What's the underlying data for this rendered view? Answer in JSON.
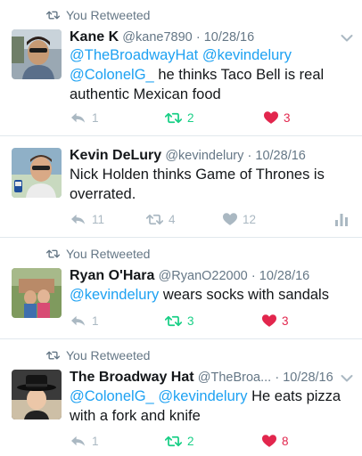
{
  "colors": {
    "accent": "#1da1f2",
    "retweet_active": "#19cf86",
    "like_active": "#e2264d",
    "muted": "#aab8c2",
    "meta": "#657786"
  },
  "tweets": [
    {
      "retweet_label": "You Retweeted",
      "name": "Kane K",
      "handle": "@kane7890",
      "date": "· 10/28/16",
      "mentions": [
        "@TheBroadwayHat",
        "@kevindelury",
        "@ColonelG_"
      ],
      "text": "he thinks Taco Bell is real authentic Mexican food",
      "replies": "1",
      "retweets": "2",
      "likes": "3",
      "avatar_icon": "avatar-kane"
    },
    {
      "retweet_label": "",
      "name": "Kevin DeLury",
      "handle": "@kevindelury",
      "date": "· 10/28/16",
      "mentions": [],
      "text": "Nick Holden thinks Game of Thrones is overrated.",
      "replies": "11",
      "retweets": "4",
      "likes": "12",
      "avatar_icon": "avatar-kevin"
    },
    {
      "retweet_label": "You Retweeted",
      "name": "Ryan O'Hara",
      "handle": "@RyanO22000",
      "date": "· 10/28/16",
      "mentions": [
        "@kevindelury"
      ],
      "text": "wears socks with sandals",
      "replies": "1",
      "retweets": "3",
      "likes": "3",
      "avatar_icon": "avatar-ryan"
    },
    {
      "retweet_label": "You Retweeted",
      "name": "The Broadway Hat",
      "handle": "@TheBroa...",
      "date": "· 10/28/16",
      "mentions": [
        "@ColonelG_",
        "@kevindelury"
      ],
      "text": "He eats pizza with a fork and knife",
      "replies": "1",
      "retweets": "2",
      "likes": "8",
      "avatar_icon": "avatar-broadway-hat"
    }
  ]
}
